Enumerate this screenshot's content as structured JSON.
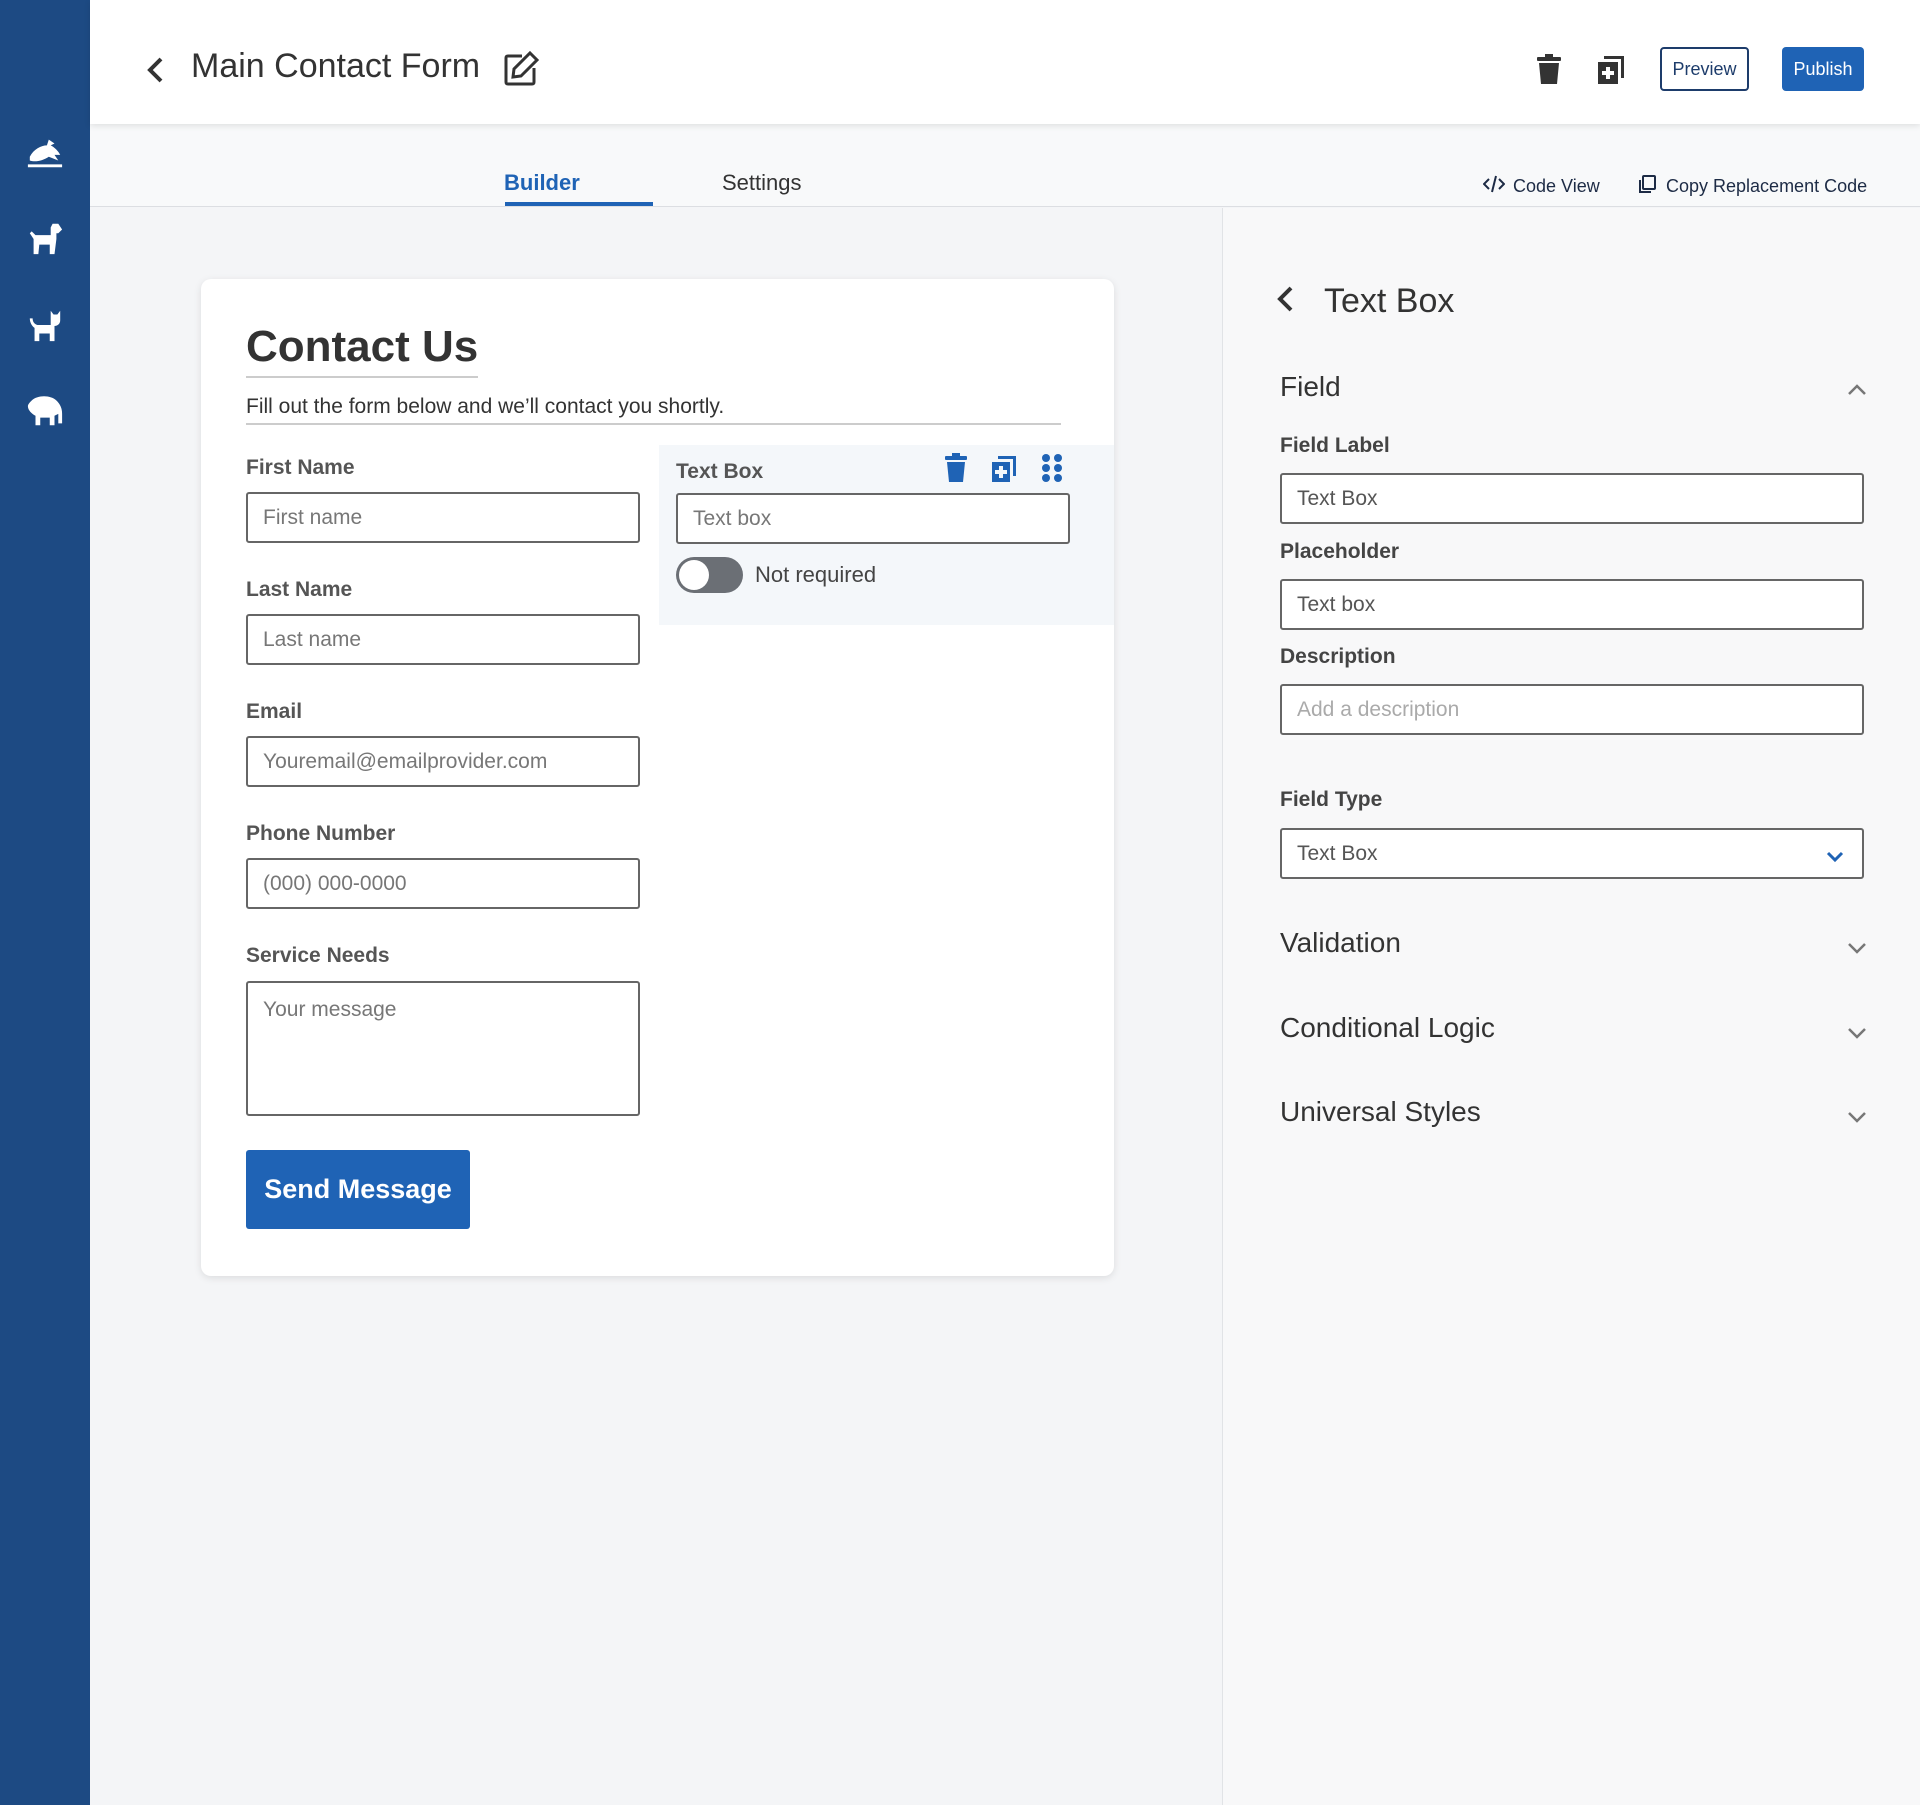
{
  "header": {
    "title": "Main Contact Form",
    "preview_label": "Preview",
    "publish_label": "Publish"
  },
  "tabs": [
    {
      "label": "Builder",
      "active": true
    },
    {
      "label": "Settings",
      "active": false
    }
  ],
  "toolbar": {
    "code_view_label": "Code View",
    "copy_code_label": "Copy Replacement Code"
  },
  "sidebar": {
    "icons": [
      "bird-icon",
      "dog-icon",
      "cat-icon",
      "elephant-icon"
    ]
  },
  "form": {
    "title": "Contact Us",
    "subtitle": "Fill out the form below and we’ll contact you shortly.",
    "fields": [
      {
        "label": "First Name",
        "placeholder": "First name"
      },
      {
        "label": "Last Name",
        "placeholder": "Last name"
      },
      {
        "label": "Email",
        "placeholder": "Youremail@emailprovider.com"
      },
      {
        "label": "Phone Number",
        "placeholder": "(000) 000-0000"
      },
      {
        "label": "Service Needs",
        "placeholder": "Your message"
      }
    ],
    "submit_label": "Send Message",
    "selected_field": {
      "label": "Text Box",
      "placeholder": "Text box",
      "toggle_label": "Not required",
      "required": false
    }
  },
  "panel": {
    "title": "Text Box",
    "section_field": "Field",
    "field_label_label": "Field Label",
    "field_label_value": "Text Box",
    "placeholder_label": "Placeholder",
    "placeholder_value": "Text box",
    "description_label": "Description",
    "description_placeholder": "Add a description",
    "field_type_label": "Field Type",
    "field_type_value": "Text Box",
    "sections": [
      "Validation",
      "Conditional Logic",
      "Universal Styles"
    ]
  },
  "colors": {
    "sidebar": "#1d4a83",
    "accent": "#1f63b5",
    "preview_border": "#1d3c6b"
  }
}
